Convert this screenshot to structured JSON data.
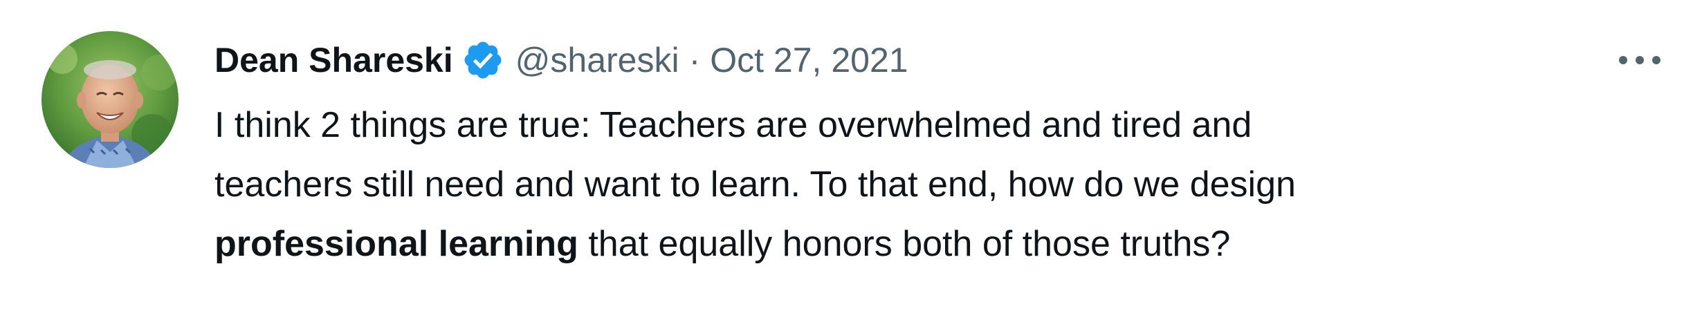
{
  "tweet": {
    "author": {
      "display_name": "Dean Shareski",
      "handle": "@shareski",
      "verified": true,
      "avatar": "profile-photo-smiling-man"
    },
    "separator": "·",
    "timestamp": "Oct 27, 2021",
    "more_icon": "more-horizontal-icon",
    "text": {
      "line1": "I think 2 things are true: Teachers are overwhelmed and tired and",
      "line2": "teachers still need and want to learn. To that end, how do we design",
      "line3_bold": "professional learning",
      "line3_rest": " that equally honors both of those truths?"
    }
  },
  "colors": {
    "text_primary": "#0f1419",
    "text_secondary": "#536471",
    "verified_badge": "#1d9bf0",
    "background": "#ffffff"
  }
}
